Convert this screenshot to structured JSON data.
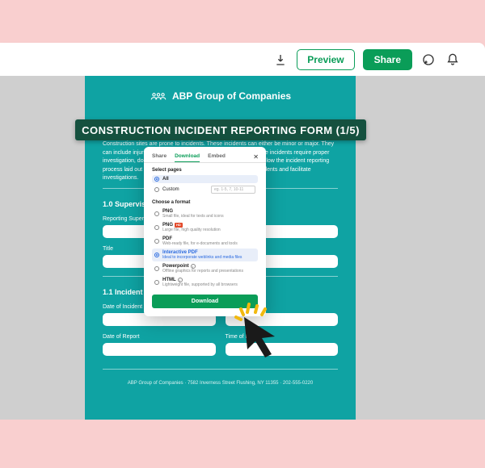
{
  "topbar": {
    "download_icon": "download-icon",
    "preview_label": "Preview",
    "share_label": "Share",
    "comment_icon": "comment-icon",
    "bell_icon": "bell-icon"
  },
  "form": {
    "brand": "ABP Group of Companies",
    "title": "CONSTRUCTION INCIDENT REPORTING FORM (1/5)",
    "intro": "Construction sites are prone to incidents. These incidents can either be minor or major. They can include injuries, illnesses, close calls, and near misses. These incidents require proper investigation, documentation, and corrective action. Be sure to follow the incident reporting process laid out in this document so that you can investigate incidents and facilitate investigations.",
    "section1": "1.0 Supervisor",
    "label_supervisor": "Reporting Supervisor",
    "label_title": "Title",
    "section2": "1.1 Incident Details",
    "label_date_incident": "Date of Incident",
    "label_date_report": "Date of Report",
    "label_time_report": "Time of Report",
    "footer": "ABP Group of Companies · 7582 Inverness Street Flushing, NY 11355 · 202-555-0220"
  },
  "modal": {
    "tabs": {
      "share": "Share",
      "download": "Download",
      "embed": "Embed"
    },
    "close": "✕",
    "select_pages": "Select pages",
    "opt_all": "All",
    "opt_custom": "Custom",
    "custom_placeholder": "eg. 1-5, 7, 10-11",
    "choose_format": "Choose a format",
    "formats": {
      "png": {
        "name": "PNG",
        "desc": "Small file, ideal for texts and icons"
      },
      "pnghd": {
        "name": "PNG",
        "badge": "HD",
        "desc": "Large file, high quality resolution"
      },
      "pdf": {
        "name": "PDF",
        "desc": "Web-ready file, for e-documents and tools"
      },
      "ipdf": {
        "name": "Interactive PDF",
        "desc": "Ideal to incorporate weblinks and media files"
      },
      "ppt": {
        "name": "Powerpoint",
        "desc": "Offline graphics for reports and presentations"
      },
      "html": {
        "name": "HTML",
        "desc": "Lightweight file, supported by all browsers"
      }
    },
    "download_btn": "Download"
  }
}
